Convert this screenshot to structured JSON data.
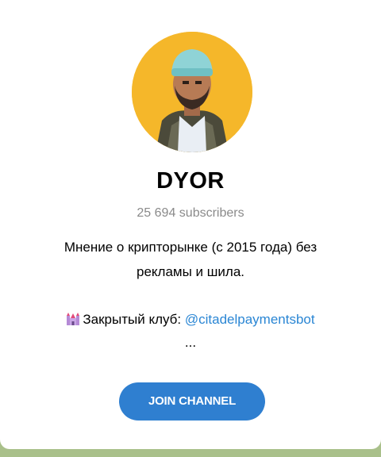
{
  "channel": {
    "name": "DYOR",
    "subscribers": "25 694 subscribers",
    "description_lines": [
      "Мнение о крипторынке (с 2015 года) без",
      "рекламы и шила."
    ],
    "club_label": "Закрытый клуб: ",
    "club_link": "@citadelpaymentsbot",
    "ellipsis": "..."
  },
  "actions": {
    "join_label": "JOIN CHANNEL"
  },
  "icons": {
    "avatar": "avatar-photo",
    "castle": "castle-icon"
  },
  "colors": {
    "accent": "#2f7fd0",
    "link": "#2a86d4",
    "avatar_bg": "#f5b72a",
    "muted_text": "#8a8a8a"
  }
}
